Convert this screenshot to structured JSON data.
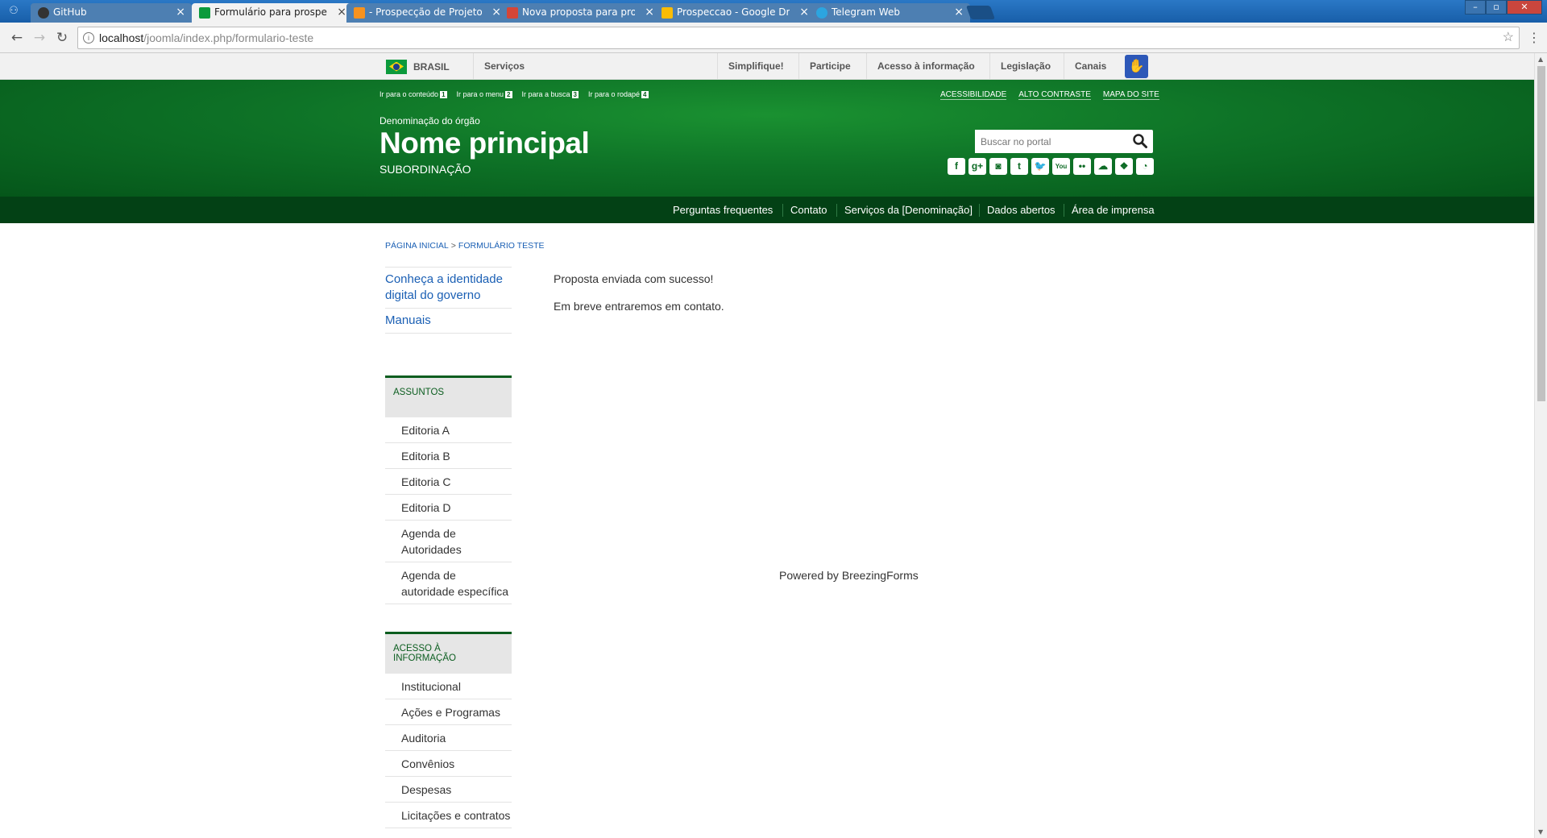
{
  "browser": {
    "tabs": [
      {
        "title": "GitHub",
        "active": false,
        "fav_color": "#333333"
      },
      {
        "title": "Formulário para prospecção",
        "active": true,
        "fav_color": "#0c9a3c"
      },
      {
        "title": "- Prospecção de Projetos",
        "active": false,
        "fav_color": "#f7921e"
      },
      {
        "title": "Nova proposta para prospecção",
        "active": false,
        "fav_color": "#d44638"
      },
      {
        "title": "Prospeccao - Google Drive",
        "active": false,
        "fav_color": "#fbbc05"
      },
      {
        "title": "Telegram Web",
        "active": false,
        "fav_color": "#2ca5e0"
      }
    ],
    "url_host": "localhost",
    "url_path": "/joomla/index.php/formulario-teste"
  },
  "govbar": {
    "brasil": "BRASIL",
    "servicos": "Serviços",
    "links": [
      "Simplifique!",
      "Participe",
      "Acesso à informação",
      "Legislação",
      "Canais"
    ]
  },
  "header": {
    "skip_links": [
      {
        "label": "Ir para o conteúdo",
        "num": "1"
      },
      {
        "label": "Ir para o menu",
        "num": "2"
      },
      {
        "label": "Ir para a busca",
        "num": "3"
      },
      {
        "label": "Ir para o rodapé",
        "num": "4"
      }
    ],
    "acc_links": [
      "ACESSIBILIDADE",
      "ALTO CONTRASTE",
      "MAPA DO SITE"
    ],
    "orgao": "Denominação do órgão",
    "nome": "Nome principal",
    "subordinacao": "SUBORDINAÇÃO",
    "search_placeholder": "Buscar no portal",
    "social": [
      "facebook-icon",
      "google-plus-icon",
      "instagram-icon",
      "tumblr-icon",
      "twitter-icon",
      "youtube-icon",
      "flickr-icon",
      "soundcloud-icon",
      "slideshare-icon",
      "rss-icon"
    ]
  },
  "mainnav": [
    "Perguntas frequentes",
    "Contato",
    "Serviços da [Denominação]",
    "Dados abertos",
    "Área de imprensa"
  ],
  "breadcrumb": {
    "home": "PÁGINA INICIAL",
    "current": "FORMULÁRIO TESTE"
  },
  "sidebar": {
    "links": [
      "Conheça a identidade digital do governo",
      "Manuais"
    ],
    "assuntos_title": "ASSUNTOS",
    "assuntos": [
      "Editoria A",
      "Editoria B",
      "Editoria C",
      "Editoria D",
      "Agenda de Autoridades",
      "Agenda de autoridade específica"
    ],
    "acesso_title": "ACESSO À INFORMAÇÃO",
    "acesso": [
      "Institucional",
      "Ações e Programas",
      "Auditoria",
      "Convênios",
      "Despesas",
      "Licitações e contratos"
    ]
  },
  "content": {
    "line1": "Proposta enviada com sucesso!",
    "line2": "Em breve entraremos em contato.",
    "powered": "Powered by BreezingForms"
  }
}
